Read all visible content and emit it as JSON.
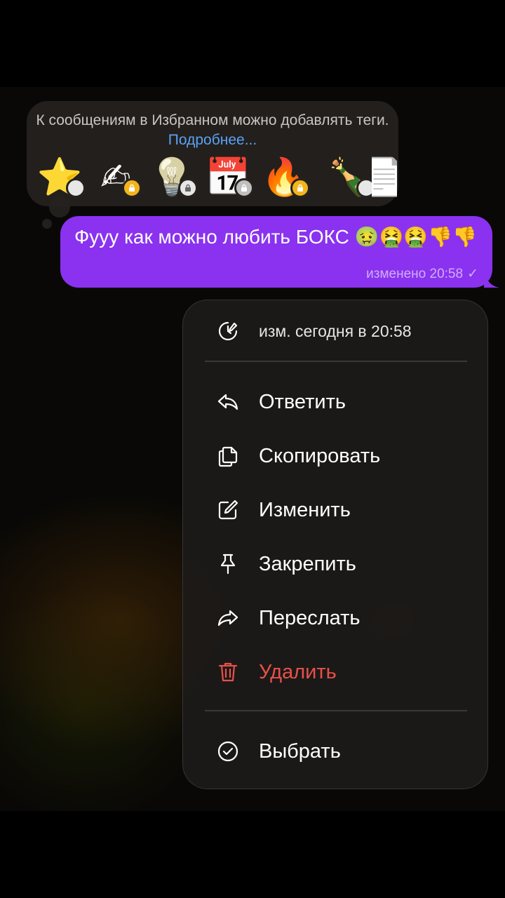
{
  "tags_bubble": {
    "text": "К сообщениям в Избранном можно добавлять теги.",
    "link": "Подробнее...",
    "emojis": [
      {
        "glyph": "⭐",
        "badge": "lock-open"
      },
      {
        "glyph": "✍",
        "badge": "lock"
      },
      {
        "glyph": "💡",
        "badge": "lock"
      },
      {
        "glyph": "📅",
        "badge": "lock"
      },
      {
        "glyph": "🔥",
        "badge": "lock"
      },
      {
        "glyph": "🍾",
        "badge": "lock-open"
      },
      {
        "glyph": "📄",
        "badge": ""
      }
    ]
  },
  "message": {
    "text": "Фууу как можно любить БОКС 🤢🤮🤮👎👎",
    "status": "изменено 20:58",
    "check": "✓",
    "bubble_color": "#8a32f0"
  },
  "menu": {
    "edited_info": "изм. сегодня в 20:58",
    "reply": "Ответить",
    "copy": "Скопировать",
    "edit": "Изменить",
    "pin": "Закрепить",
    "forward": "Переслать",
    "delete": "Удалить",
    "select": "Выбрать",
    "danger_color": "#e8504a"
  }
}
